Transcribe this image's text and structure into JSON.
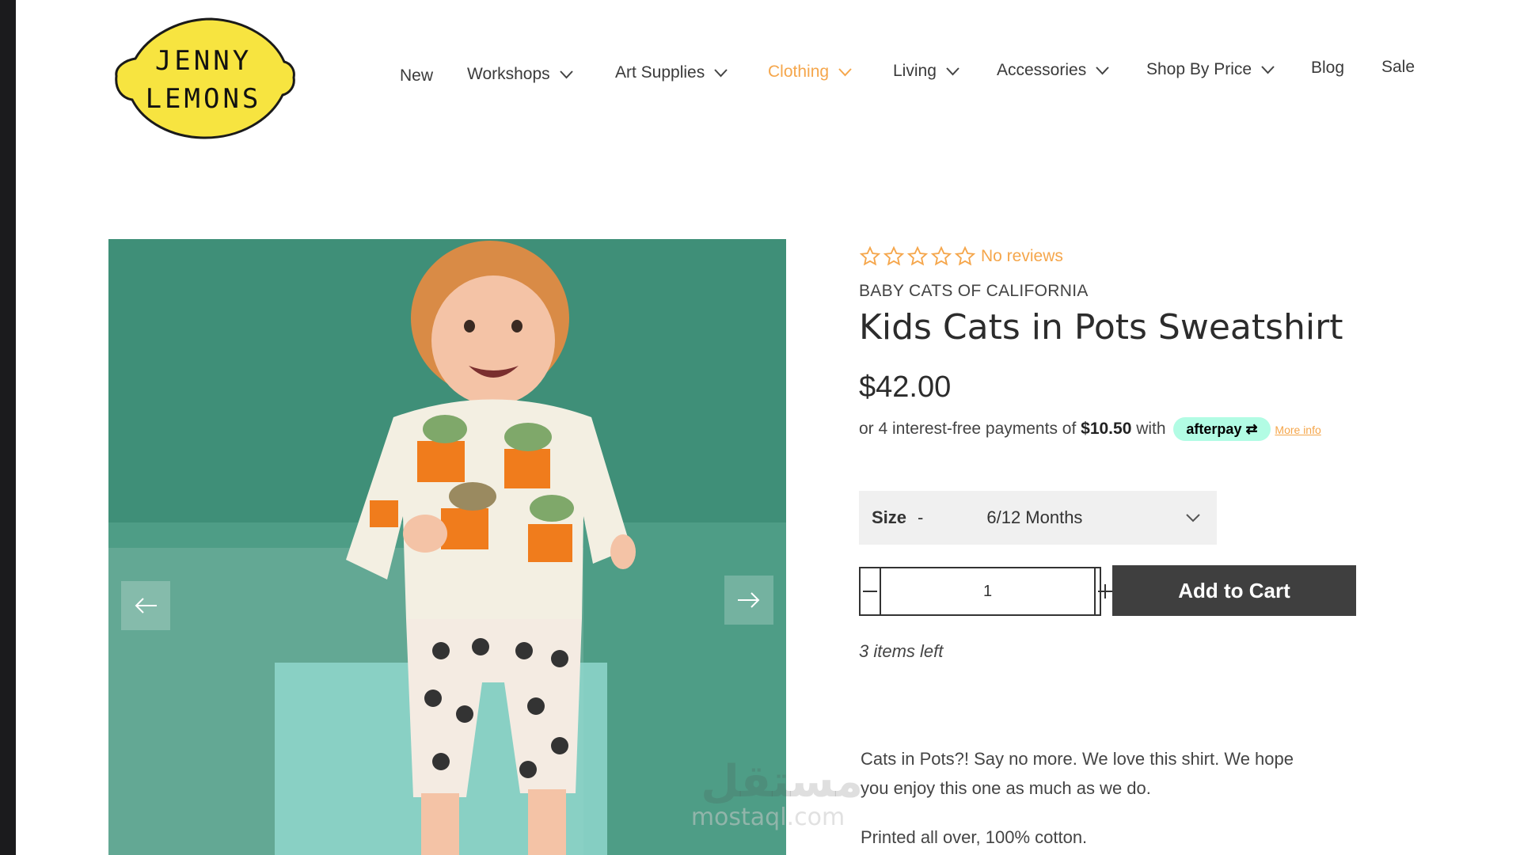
{
  "logo": {
    "line1": "JENNY",
    "line2": "LEMONS",
    "color": "#f7e440"
  },
  "nav": {
    "items": [
      {
        "label": "New",
        "dropdown": false,
        "active": false
      },
      {
        "label": "Workshops",
        "dropdown": true,
        "active": false
      },
      {
        "label": "Art Supplies",
        "dropdown": true,
        "active": false
      },
      {
        "label": "Clothing",
        "dropdown": true,
        "active": true
      },
      {
        "label": "Living",
        "dropdown": true,
        "active": false
      },
      {
        "label": "Accessories",
        "dropdown": true,
        "active": false
      },
      {
        "label": "Shop By Price",
        "dropdown": true,
        "active": false
      },
      {
        "label": "Blog",
        "dropdown": false,
        "active": false
      },
      {
        "label": "Sale",
        "dropdown": false,
        "active": false
      }
    ],
    "active_color": "#f5a64b"
  },
  "product": {
    "rating": {
      "stars": 0,
      "max": 5,
      "reviews_label": "No reviews"
    },
    "vendor": "BABY CATS OF CALIFORNIA",
    "title": "Kids Cats in Pots Sweatshirt",
    "price": "$42.00",
    "afterpay": {
      "prefix": "or 4 interest-free payments of",
      "amount": "$10.50",
      "with": "with",
      "badge": "afterpay",
      "more_info": "More info"
    },
    "size": {
      "label": "Size",
      "separator": "-",
      "selected": "6/12 Months"
    },
    "quantity": "1",
    "add_to_cart": "Add to Cart",
    "stock": "3 items left",
    "description": "Cats in Pots?! Say no more. We love this shirt. We hope you enjoy this one as much as we do.",
    "material": "Printed all over, 100% cotton."
  },
  "watermark": {
    "arabic": "مستقل",
    "latin": "mostaql.com"
  },
  "colors": {
    "accent": "#f5a64b",
    "button": "#3f3f3f",
    "afterpay": "#b2fce4",
    "image_bg": "#3f8f78"
  }
}
